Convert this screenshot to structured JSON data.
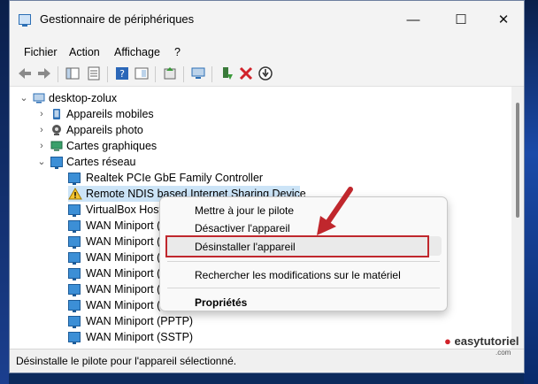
{
  "window": {
    "title": "Gestionnaire de périphériques",
    "minimize": "—",
    "maximize": "☐",
    "close": "✕"
  },
  "menu": [
    "Fichier",
    "Action",
    "Affichage",
    "?"
  ],
  "tree": {
    "root": "desktop-zolux",
    "categories": [
      "Appareils mobiles",
      "Appareils photo",
      "Cartes graphiques",
      "Cartes réseau"
    ],
    "network_devices": [
      "Realtek PCIe GbE Family Controller",
      "Remote NDIS based Internet Sharing Device",
      "VirtualBox Host",
      "WAN Miniport (",
      "WAN Miniport (",
      "WAN Miniport (",
      "WAN Miniport (",
      "WAN Miniport (",
      "WAN Miniport (",
      "WAN Miniport (PPTP)",
      "WAN Miniport (SSTP)"
    ]
  },
  "context_menu": {
    "update": "Mettre à jour le pilote",
    "disable": "Désactiver l'appareil",
    "uninstall": "Désinstaller l'appareil",
    "scan": "Rechercher les modifications sur le matériel",
    "properties": "Propriétés"
  },
  "statusbar": "Désinstalle le pilote pour l'appareil sélectionné.",
  "watermark": {
    "brand": "easytutoriel",
    "sub": ".com"
  },
  "colors": {
    "highlight_box": "#c0272d",
    "arrow": "#c0272d",
    "selected_row": "#cce4f7"
  }
}
